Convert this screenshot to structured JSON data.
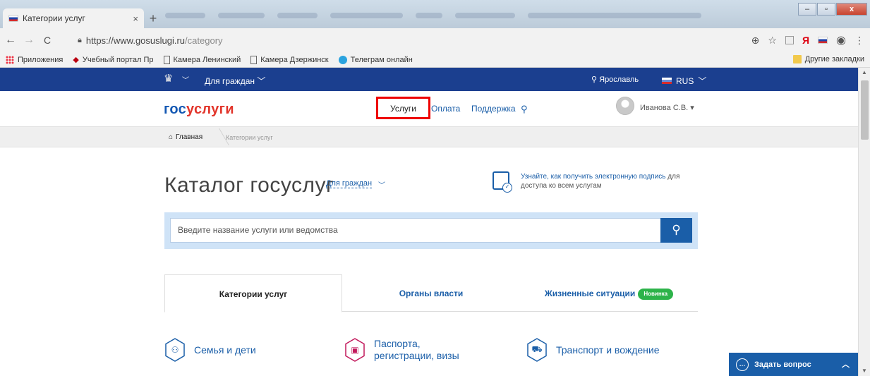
{
  "browser": {
    "tab_title": "Категории услуг",
    "tab_close": "×",
    "new_tab": "+",
    "back": "←",
    "forward": "→",
    "reload": "C",
    "url_host": "https://www.gosuslugi.ru",
    "url_path": "/category",
    "zoom_icon": "⊕",
    "star_icon": "☆",
    "yandex": "Я",
    "menu": "⋮",
    "bookmarks": [
      {
        "label": "Приложения",
        "icon": "apps-icon"
      },
      {
        "label": "Учебный портал Пр",
        "icon": "graduation-cap-icon"
      },
      {
        "label": "Камера Ленинский",
        "icon": "page-icon"
      },
      {
        "label": "Камера Дзержинск",
        "icon": "page-icon"
      },
      {
        "label": "Телеграм онлайн",
        "icon": "telegram-icon"
      }
    ],
    "other_bookmarks": "Другие закладки"
  },
  "topnav": {
    "for_citizens": "Для граждан",
    "city": "Ярославль",
    "lang": "RUS"
  },
  "header": {
    "logo_a": "гос",
    "logo_b": "услуги",
    "services": "Услуги",
    "pay": "Оплата",
    "support": "Поддержка",
    "user": "Иванова С.В. ▾"
  },
  "breadcrumb": {
    "home": "Главная",
    "current": "Категории услуг"
  },
  "catalog": {
    "title": "Каталог госуслуг",
    "for_label": "Для граждан",
    "esign_link": "Узнайте, как получить электронную подпись",
    "esign_rest": " для доступа ко всем услугам",
    "search_placeholder": "Введите название услуги или ведомства"
  },
  "tabs": {
    "categories": "Категории услуг",
    "authorities": "Органы власти",
    "life": "Жизненные ситуации",
    "new_badge": "Новинка"
  },
  "categories": {
    "family": "Семья и дети",
    "passport_1": "Паспорта,",
    "passport_2": "регистрации, визы",
    "transport": "Транспорт и вождение"
  },
  "ask": {
    "label": "Задать вопрос"
  },
  "colors": {
    "brand_blue": "#1a5ea8",
    "brand_red": "#e2352b",
    "highlight_box": "#e00000",
    "new_badge": "#2db34a"
  }
}
